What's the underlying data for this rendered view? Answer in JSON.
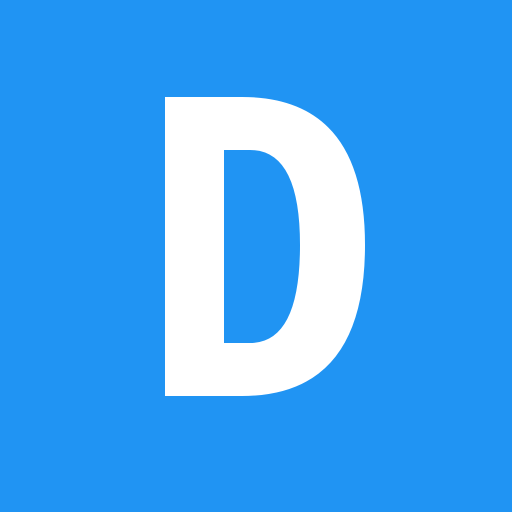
{
  "tile": {
    "letter": "D",
    "background_color": "#2094f3",
    "letter_color": "#ffffff"
  }
}
